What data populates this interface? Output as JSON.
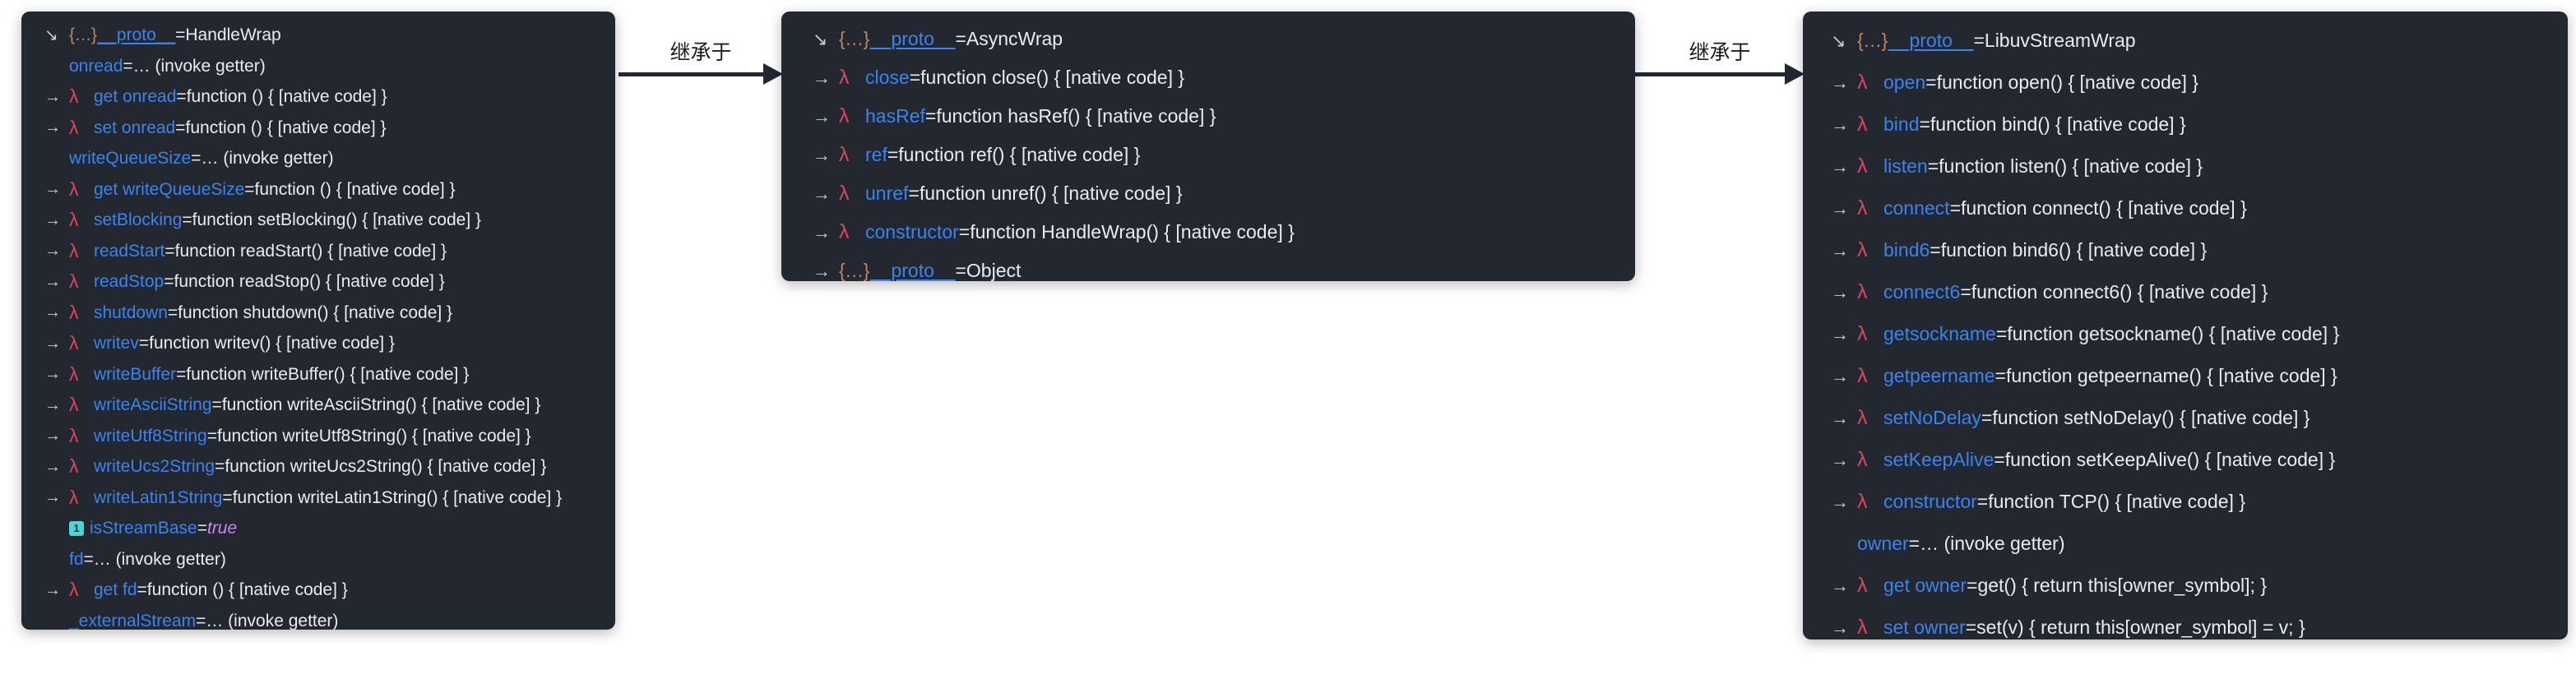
{
  "page": {
    "background": "#ffffff",
    "panel_background": "#23272f",
    "key_color": "#3b84f0",
    "lambda_color": "#e0435c",
    "brace_color": "#c08563",
    "value_color": "#e9ecf1",
    "bool_color": "#c586f0",
    "badge_color": "#4dd4d4"
  },
  "arrows": [
    {
      "label": "继承于"
    },
    {
      "label": "继承于"
    }
  ],
  "panels": [
    {
      "id": "handlewrap-panel",
      "title_row": {
        "gutter": "↘",
        "braces": "{…}",
        "key": "__proto__",
        "eq": " = ",
        "value": "HandleWrap"
      },
      "rows": [
        {
          "gutter": "",
          "icon": "none",
          "key": "onread",
          "eq": " = ",
          "value": "…  (invoke getter)"
        },
        {
          "gutter": "→",
          "icon": "lambda",
          "key": "get onread",
          "eq": " = ",
          "value": "function () { [native code] }"
        },
        {
          "gutter": "→",
          "icon": "lambda",
          "key": "set onread",
          "eq": " = ",
          "value": "function () { [native code] }"
        },
        {
          "gutter": "",
          "icon": "none",
          "key": "writeQueueSize",
          "eq": " = ",
          "value": "…  (invoke getter)"
        },
        {
          "gutter": "→",
          "icon": "lambda",
          "key": "get writeQueueSize",
          "eq": " = ",
          "value": "function () { [native code] }"
        },
        {
          "gutter": "→",
          "icon": "lambda",
          "key": "setBlocking",
          "eq": " = ",
          "value": "function setBlocking() { [native code] }"
        },
        {
          "gutter": "→",
          "icon": "lambda",
          "key": "readStart",
          "eq": " = ",
          "value": "function readStart() { [native code] }"
        },
        {
          "gutter": "→",
          "icon": "lambda",
          "key": "readStop",
          "eq": " = ",
          "value": "function readStop() { [native code] }"
        },
        {
          "gutter": "→",
          "icon": "lambda",
          "key": "shutdown",
          "eq": " = ",
          "value": "function shutdown() { [native code] }"
        },
        {
          "gutter": "→",
          "icon": "lambda",
          "key": "writev",
          "eq": " = ",
          "value": "function writev() { [native code] }"
        },
        {
          "gutter": "→",
          "icon": "lambda",
          "key": "writeBuffer",
          "eq": " = ",
          "value": "function writeBuffer() { [native code] }"
        },
        {
          "gutter": "→",
          "icon": "lambda",
          "key": "writeAsciiString",
          "eq": " = ",
          "value": "function writeAsciiString() { [native code] }"
        },
        {
          "gutter": "→",
          "icon": "lambda",
          "key": "writeUtf8String",
          "eq": " = ",
          "value": "function writeUtf8String() { [native code] }"
        },
        {
          "gutter": "→",
          "icon": "lambda",
          "key": "writeUcs2String",
          "eq": " = ",
          "value": "function writeUcs2String() { [native code] }"
        },
        {
          "gutter": "→",
          "icon": "lambda",
          "key": "writeLatin1String",
          "eq": " = ",
          "value": "function writeLatin1String() { [native code] }"
        },
        {
          "gutter": "",
          "icon": "badge1",
          "key": "isStreamBase",
          "eq": " = ",
          "value": "true",
          "value_kind": "bool"
        },
        {
          "gutter": "",
          "icon": "none",
          "key": "fd",
          "eq": " = ",
          "value": "…  (invoke getter)"
        },
        {
          "gutter": "→",
          "icon": "lambda",
          "key": "get fd",
          "eq": " = ",
          "value": "function () { [native code] }"
        },
        {
          "gutter": "",
          "icon": "none",
          "key": "_externalStream",
          "eq": " = ",
          "value": "…  (invoke getter)"
        }
      ]
    },
    {
      "id": "asyncwrap-panel",
      "title_row": {
        "gutter": "↘",
        "braces": "{…}",
        "key": "__proto__",
        "eq": " = ",
        "value": "AsyncWrap"
      },
      "rows": [
        {
          "gutter": "→",
          "icon": "lambda",
          "key": "close",
          "eq": " = ",
          "value": "function close() { [native code] }"
        },
        {
          "gutter": "→",
          "icon": "lambda",
          "key": "hasRef",
          "eq": " = ",
          "value": "function hasRef() { [native code] }"
        },
        {
          "gutter": "→",
          "icon": "lambda",
          "key": "ref",
          "eq": " = ",
          "value": "function ref() { [native code] }"
        },
        {
          "gutter": "→",
          "icon": "lambda",
          "key": "unref",
          "eq": " = ",
          "value": "function unref() { [native code] }"
        },
        {
          "gutter": "→",
          "icon": "lambda",
          "key": "constructor",
          "eq": " = ",
          "value": "function HandleWrap() { [native code] }"
        },
        {
          "gutter": "→",
          "icon": "braces",
          "key": "__proto__",
          "eq": " = ",
          "value": "Object"
        }
      ]
    },
    {
      "id": "libuvstreamwrap-panel",
      "title_row": {
        "gutter": "↘",
        "braces": "{…}",
        "key": "__proto__",
        "eq": " = ",
        "value": "LibuvStreamWrap"
      },
      "rows": [
        {
          "gutter": "→",
          "icon": "lambda",
          "key": "open",
          "eq": " = ",
          "value": "function open() { [native code] }"
        },
        {
          "gutter": "→",
          "icon": "lambda",
          "key": "bind",
          "eq": " = ",
          "value": "function bind() { [native code] }"
        },
        {
          "gutter": "→",
          "icon": "lambda",
          "key": "listen",
          "eq": " = ",
          "value": "function listen() { [native code] }"
        },
        {
          "gutter": "→",
          "icon": "lambda",
          "key": "connect",
          "eq": " = ",
          "value": "function connect() { [native code] }"
        },
        {
          "gutter": "→",
          "icon": "lambda",
          "key": "bind6",
          "eq": " = ",
          "value": "function bind6() { [native code] }"
        },
        {
          "gutter": "→",
          "icon": "lambda",
          "key": "connect6",
          "eq": " = ",
          "value": "function connect6() { [native code] }"
        },
        {
          "gutter": "→",
          "icon": "lambda",
          "key": "getsockname",
          "eq": " = ",
          "value": "function getsockname() { [native code] }"
        },
        {
          "gutter": "→",
          "icon": "lambda",
          "key": "getpeername",
          "eq": " = ",
          "value": "function getpeername() { [native code] }"
        },
        {
          "gutter": "→",
          "icon": "lambda",
          "key": "setNoDelay",
          "eq": " = ",
          "value": "function setNoDelay() { [native code] }"
        },
        {
          "gutter": "→",
          "icon": "lambda",
          "key": "setKeepAlive",
          "eq": " = ",
          "value": "function setKeepAlive() { [native code] }"
        },
        {
          "gutter": "→",
          "icon": "lambda",
          "key": "constructor",
          "eq": " = ",
          "value": "function TCP() { [native code] }"
        },
        {
          "gutter": "",
          "icon": "none",
          "key": "owner",
          "eq": " = ",
          "value": "…  (invoke getter)"
        },
        {
          "gutter": "→",
          "icon": "lambda",
          "key": "get owner",
          "eq": " = ",
          "value": "get() { return this[owner_symbol]; }"
        },
        {
          "gutter": "→",
          "icon": "lambda",
          "key": "set owner",
          "eq": " = ",
          "value": "set(v) { return this[owner_symbol] = v; }"
        }
      ]
    }
  ]
}
